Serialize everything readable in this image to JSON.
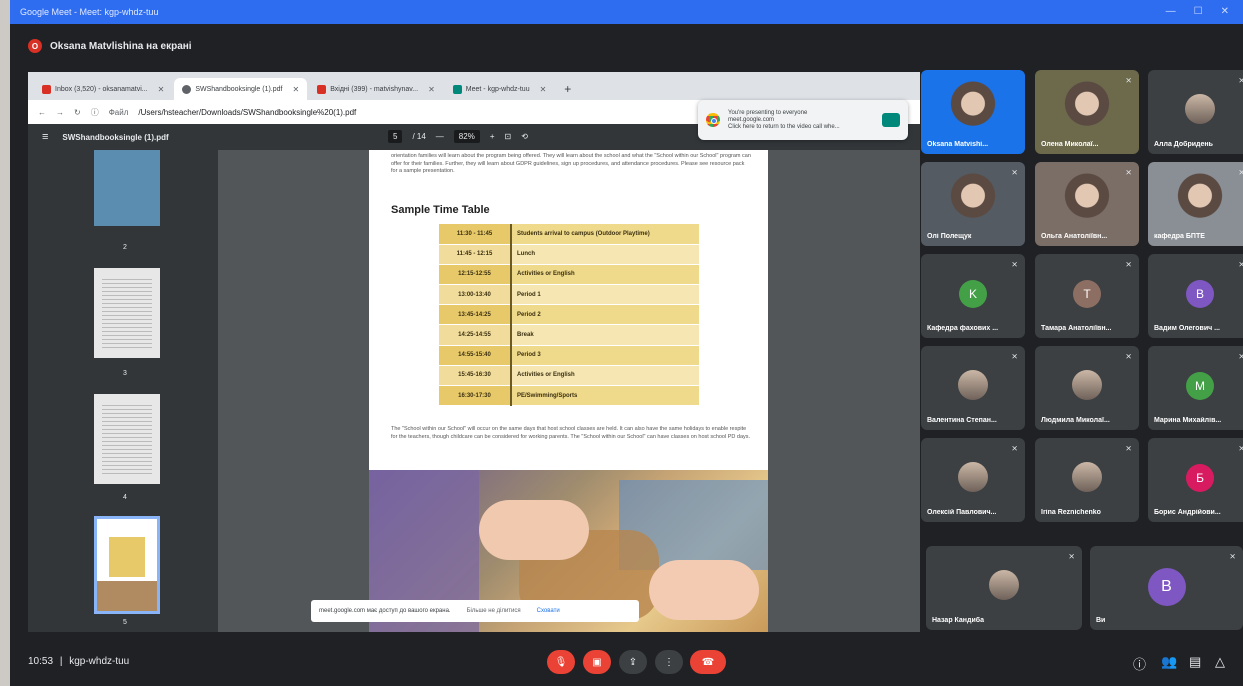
{
  "titlebar": {
    "title": "Google Meet - Meet: kgp-whdz-tuu"
  },
  "presenter": {
    "initial": "O",
    "text": "Oksana Matvlishina на екрані"
  },
  "browser": {
    "tabs": [
      {
        "label": "Inbox (3,520) - oksanamatvi...",
        "color": "#d93025"
      },
      {
        "label": "SWShandbooksingle (1).pdf",
        "color": "#5f6368"
      },
      {
        "label": "Вхідні (399) - matvishynav...",
        "color": "#d93025"
      },
      {
        "label": "Meet - kgp-whdz-tuu",
        "color": "#00897b"
      }
    ],
    "url_scheme": "Файл",
    "url": "/Users/hsteacher/Downloads/SWShandbooksingle%20(1).pdf"
  },
  "pdf": {
    "filename": "SWShandbooksingle (1).pdf",
    "page": "5",
    "total": "/ 14",
    "zoom": "82%",
    "thumb_numbers": [
      "2",
      "3",
      "4",
      "5"
    ],
    "intro": "orientation families will learn about the program being offered. They will learn about the school and what the \"School within our School\" program can offer for their families. Further, they will learn about GDPR guidelines, sign up procedures, and attendance procedures. Please see resource pack for a sample presentation.",
    "table_title": "Sample Time Table",
    "schedule": [
      {
        "time": "11:30 - 11:45",
        "activity": "Students arrival to campus (Outdoor Playtime)"
      },
      {
        "time": "11:45 - 12:15",
        "activity": "Lunch"
      },
      {
        "time": "12:15-12:55",
        "activity": "Activities or English"
      },
      {
        "time": "13:00-13:40",
        "activity": "Period 1"
      },
      {
        "time": "13:45-14:25",
        "activity": "Period 2"
      },
      {
        "time": "14:25-14:55",
        "activity": "Break"
      },
      {
        "time": "14:55-15:40",
        "activity": "Period 3"
      },
      {
        "time": "15:45-16:30",
        "activity": "Activities or English"
      },
      {
        "time": "16:30-17:30",
        "activity": "PE/Swimming/Sports"
      }
    ],
    "outro": "The \"School within our School\" will occur on the same days that host school classes are held. It can also have the same holidays to enable respite for the teachers, though childcare can be considered for working parents. The \"School within our School\" can have classes on host school PD days."
  },
  "presenting_popup": {
    "line1": "You're presenting to everyone",
    "line2": "meet.google.com",
    "line3": "Click here to return to the video call whe..."
  },
  "share_notice": {
    "text": "meet.google.com має доступ до вашого екрана.",
    "hide": "Більше не ділитися",
    "close": "Сховати"
  },
  "participants": [
    {
      "name": "Oksana Matvishi...",
      "type": "video",
      "bg": "#1a73e8"
    },
    {
      "name": "Олена Миколаї...",
      "type": "video",
      "bg": "#6d6a4c"
    },
    {
      "name": "Алла Добридень",
      "type": "photo",
      "bg": "#3c4043"
    },
    {
      "name": "Олі Полещук",
      "type": "video",
      "bg": "#555b62"
    },
    {
      "name": "Ольга Анатоліївн...",
      "type": "video",
      "bg": "#7b6e66"
    },
    {
      "name": "кафедра БПТЕ",
      "type": "video",
      "bg": "#8a8f96"
    },
    {
      "name": "Кафедра фахових ...",
      "initial": "K",
      "color": "#43a047"
    },
    {
      "name": "Тамара Анатоліївн...",
      "initial": "T",
      "color": "#8d6e63"
    },
    {
      "name": "Вадим Олегович ...",
      "initial": "B",
      "color": "#7e57c2"
    },
    {
      "name": "Валентина Степан...",
      "type": "photo"
    },
    {
      "name": "Людмила Миколаї...",
      "type": "photo"
    },
    {
      "name": "Марина Михайлів...",
      "initial": "M",
      "color": "#43a047"
    },
    {
      "name": "Олексій Павлович...",
      "type": "photo"
    },
    {
      "name": "Irina Reznichenko",
      "type": "photo"
    },
    {
      "name": "Борис Андрійови...",
      "initial": "Б",
      "color": "#d81b60"
    },
    {
      "name": "Назар Кандиба",
      "type": "photo"
    },
    {
      "name": "Ви",
      "initial": "B",
      "color": "#7e57c2"
    }
  ],
  "bottom": {
    "time": "10:53",
    "separator": "|",
    "code": "kgp-whdz-tuu"
  }
}
